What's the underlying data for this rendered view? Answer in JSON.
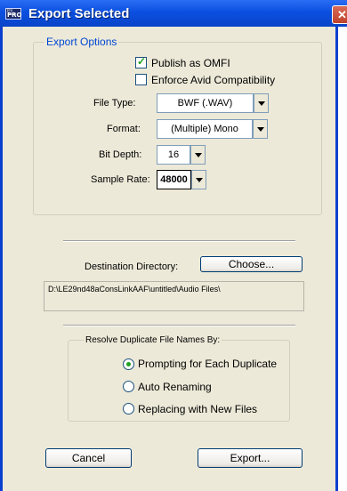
{
  "window": {
    "title": "Export Selected",
    "app_icon": {
      "name": "protools-app-icon",
      "top_text": "Pro Tools",
      "bottom_text": "PRO"
    }
  },
  "export_options": {
    "group_label": "Export Options",
    "publish_omfi": {
      "label": "Publish as OMFI",
      "checked": true
    },
    "enforce_avid": {
      "label": "Enforce Avid Compatibility",
      "checked": false
    },
    "file_type": {
      "label": "File Type:",
      "value": "BWF (.WAV)"
    },
    "format": {
      "label": "Format:",
      "value": "(Multiple) Mono"
    },
    "bit_depth": {
      "label": "Bit Depth:",
      "value": "16"
    },
    "sample_rate": {
      "label": "Sample Rate:",
      "value": "48000"
    }
  },
  "destination": {
    "label": "Destination Directory:",
    "choose_button": "Choose...",
    "path": "D:\\LE29nd48aConsLinkAAF\\untitled\\Audio Files\\"
  },
  "resolve": {
    "group_label": "Resolve Duplicate File Names By:",
    "options": [
      {
        "label": "Prompting for Each Duplicate",
        "selected": true
      },
      {
        "label": "Auto Renaming",
        "selected": false
      },
      {
        "label": "Replacing with New Files",
        "selected": false
      }
    ]
  },
  "buttons": {
    "cancel": "Cancel",
    "export": "Export..."
  },
  "icons": {
    "close": "close-icon",
    "dropdown": "chevron-down-icon",
    "check": "checkmark-icon"
  }
}
